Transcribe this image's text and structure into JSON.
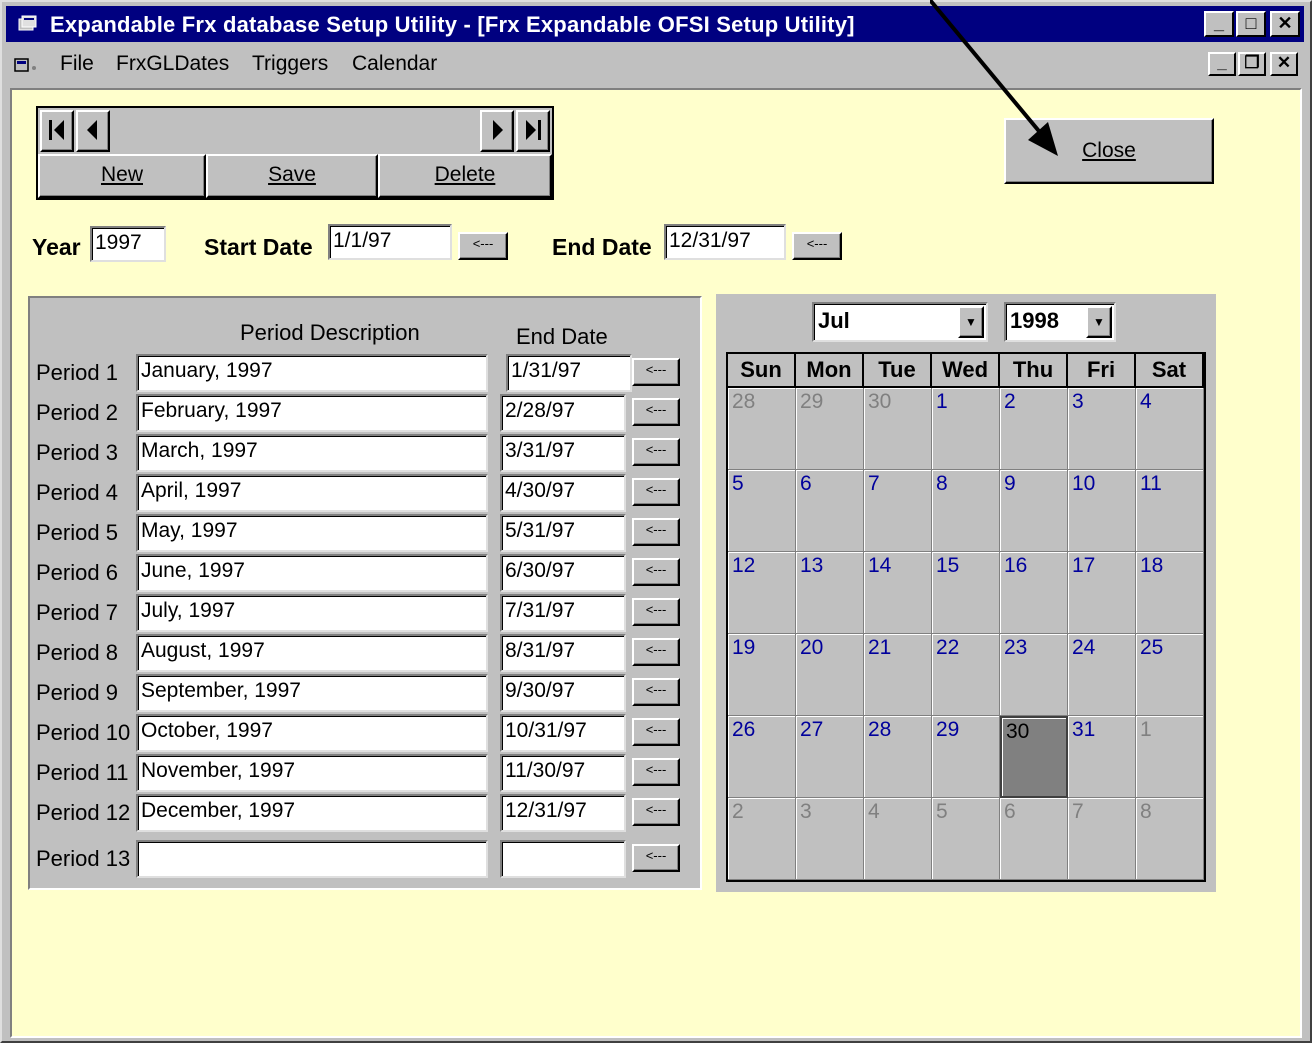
{
  "window": {
    "title": "Expandable Frx database Setup Utility - [Frx Expandable OFSI Setup Utility]"
  },
  "menu": [
    "File",
    "FrxGLDates",
    "Triggers",
    "Calendar"
  ],
  "navigator": {
    "new_label": "New",
    "save_label": "Save",
    "delete_label": "Delete"
  },
  "close_label": "Close",
  "year": {
    "label": "Year",
    "value": "1997"
  },
  "start_date": {
    "label": "Start Date",
    "value": "1/1/97",
    "btn": "<---"
  },
  "end_date": {
    "label": "End Date",
    "value": "12/31/97",
    "btn": "<---"
  },
  "periods": {
    "desc_header": "Period Description",
    "end_header": "End Date",
    "btn": "<---",
    "rows": [
      {
        "label": "Period 1",
        "desc": "January, 1997",
        "end": "1/31/97"
      },
      {
        "label": "Period 2",
        "desc": "February, 1997",
        "end": "2/28/97"
      },
      {
        "label": "Period 3",
        "desc": "March, 1997",
        "end": "3/31/97"
      },
      {
        "label": "Period 4",
        "desc": "April, 1997",
        "end": "4/30/97"
      },
      {
        "label": "Period 5",
        "desc": "May, 1997",
        "end": "5/31/97"
      },
      {
        "label": "Period 6",
        "desc": "June, 1997",
        "end": "6/30/97"
      },
      {
        "label": "Period 7",
        "desc": "July, 1997",
        "end": "7/31/97"
      },
      {
        "label": "Period 8",
        "desc": "August, 1997",
        "end": "8/31/97"
      },
      {
        "label": "Period 9",
        "desc": "September, 1997",
        "end": "9/30/97"
      },
      {
        "label": "Period 10",
        "desc": "October, 1997",
        "end": "10/31/97"
      },
      {
        "label": "Period 11",
        "desc": "November, 1997",
        "end": "11/30/97"
      },
      {
        "label": "Period 12",
        "desc": "December, 1997",
        "end": "12/31/97"
      },
      {
        "label": "Period 13",
        "desc": "",
        "end": ""
      }
    ]
  },
  "calendar": {
    "month": "Jul",
    "year": "1998",
    "weekdays": [
      "Sun",
      "Mon",
      "Tue",
      "Wed",
      "Thu",
      "Fri",
      "Sat"
    ],
    "days": [
      "28",
      "29",
      "30",
      "1",
      "2",
      "3",
      "4",
      "5",
      "6",
      "7",
      "8",
      "9",
      "10",
      "11",
      "12",
      "13",
      "14",
      "15",
      "16",
      "17",
      "18",
      "19",
      "20",
      "21",
      "22",
      "23",
      "24",
      "25",
      "26",
      "27",
      "28",
      "29",
      "30",
      "31",
      "1",
      "2",
      "3",
      "4",
      "5",
      "6",
      "7",
      "8"
    ],
    "current_month_range": [
      3,
      33
    ],
    "selected_index": 32
  }
}
